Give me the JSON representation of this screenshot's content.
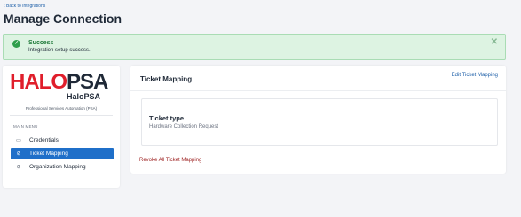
{
  "nav": {
    "back_label": "‹ Back to Integrations"
  },
  "page": {
    "title": "Manage Connection"
  },
  "alert": {
    "title": "Success",
    "message": "Integration setup success.",
    "close_symbol": "✕",
    "icon": "check-circle-icon",
    "color": "#2f9e4c"
  },
  "sidebar": {
    "logo_halo": "HALO",
    "logo_psa": "PSA",
    "logo_sub": "HaloPSA",
    "tagline": "Professional Services Automation (PSA)",
    "menu_heading": "MAIN MENU",
    "items": [
      {
        "label": "Credentials",
        "icon": "credentials-icon",
        "active": false
      },
      {
        "label": "Ticket Mapping",
        "icon": "link-icon",
        "active": true
      },
      {
        "label": "Organization Mapping",
        "icon": "link-icon",
        "active": false
      }
    ],
    "active_color": "#1f6fc9"
  },
  "panel": {
    "title": "Ticket Mapping",
    "edit_label": "Edit Ticket Mapping",
    "ticket_type_label": "Ticket type",
    "ticket_type_value": "Hardware Collection Request",
    "revoke_label": "Revoke All Ticket Mapping"
  }
}
